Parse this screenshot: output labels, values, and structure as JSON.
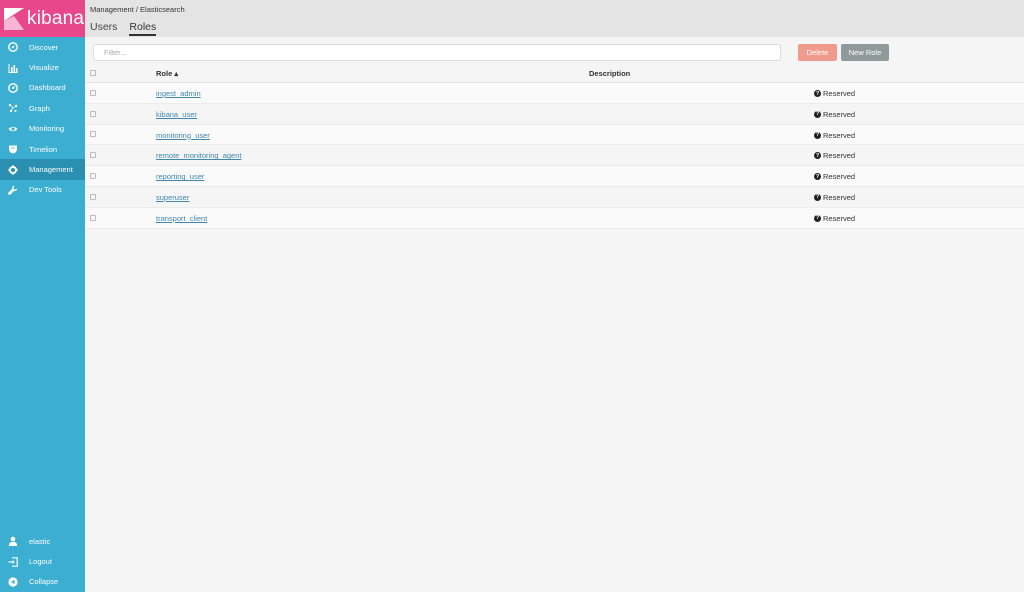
{
  "app": {
    "logo_text": "kibana"
  },
  "sidebar": {
    "items": [
      {
        "label": "Discover",
        "icon": "compass-icon"
      },
      {
        "label": "Visualize",
        "icon": "bar-chart-icon"
      },
      {
        "label": "Dashboard",
        "icon": "dashboard-icon"
      },
      {
        "label": "Graph",
        "icon": "graph-icon"
      },
      {
        "label": "Monitoring",
        "icon": "eye-icon"
      },
      {
        "label": "Timelion",
        "icon": "shield-icon"
      },
      {
        "label": "Management",
        "icon": "gear-icon"
      },
      {
        "label": "Dev Tools",
        "icon": "wrench-icon"
      }
    ],
    "bottom": [
      {
        "label": "elastic",
        "icon": "user-icon"
      },
      {
        "label": "Logout",
        "icon": "logout-icon"
      },
      {
        "label": "Collapse",
        "icon": "collapse-icon"
      }
    ],
    "active": "Management"
  },
  "header": {
    "breadcrumb": "Management / Elasticsearch",
    "tabs": [
      {
        "label": "Users"
      },
      {
        "label": "Roles"
      }
    ],
    "active_tab": "Roles"
  },
  "toolbar": {
    "filter_placeholder": "Filter...",
    "delete_label": "Delete",
    "new_role_label": "New Role"
  },
  "table": {
    "columns": [
      {
        "label": "Role ▴"
      },
      {
        "label": "Description"
      }
    ],
    "rows": [
      {
        "role": "ingest_admin",
        "status": "Reserved"
      },
      {
        "role": "kibana_user",
        "status": "Reserved"
      },
      {
        "role": "monitoring_user",
        "status": "Reserved"
      },
      {
        "role": "remote_monitoring_agent",
        "status": "Reserved"
      },
      {
        "role": "reporting_user",
        "status": "Reserved"
      },
      {
        "role": "superuser",
        "status": "Reserved"
      },
      {
        "role": "transport_client",
        "status": "Reserved"
      }
    ]
  },
  "colors": {
    "sidebar": "#3caed2",
    "sidebar_active": "#2a8fb1",
    "logo_bg": "#e8488b",
    "delete_button": "#f19b8e",
    "new_role_button": "#909a9b",
    "link": "#3f87ad"
  }
}
